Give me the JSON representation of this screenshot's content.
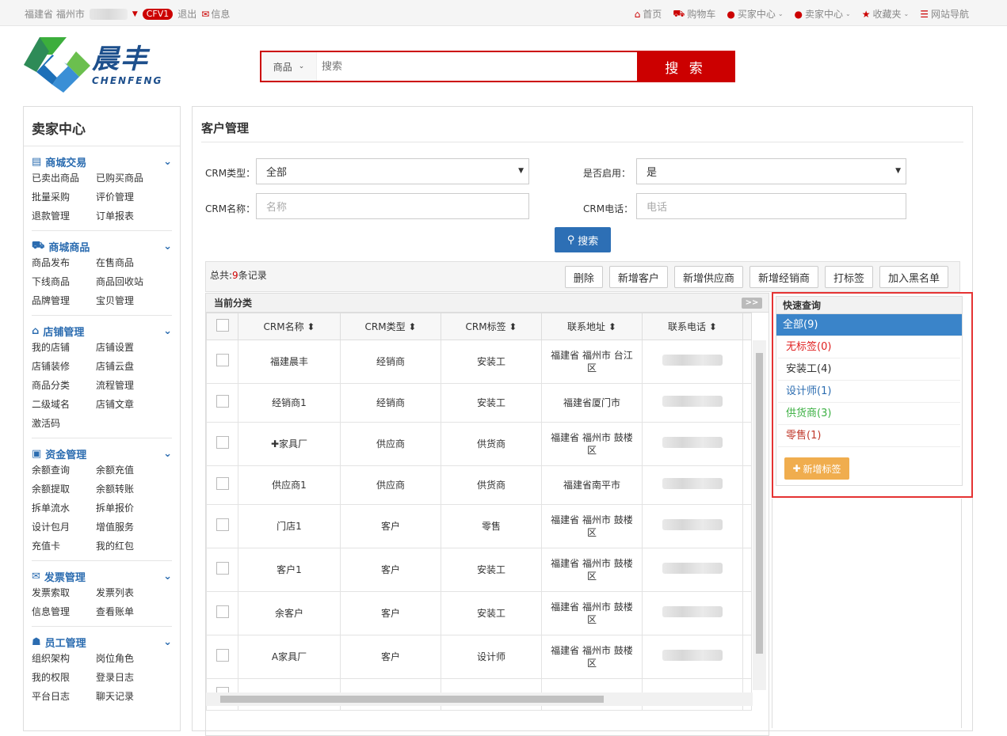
{
  "topbar": {
    "location": "福建省 福州市",
    "badge": "CFV1",
    "logout": "退出",
    "message": "信息",
    "right": {
      "home": "首页",
      "cart": "购物车",
      "buyer": "买家中心",
      "seller": "卖家中心",
      "favorites": "收藏夹",
      "sitenav": "网站导航"
    }
  },
  "logo": {
    "cn": "晨丰",
    "en": "CHENFENG"
  },
  "search": {
    "category": "商品",
    "placeholder": "搜索",
    "button": "搜 索"
  },
  "sidebar": {
    "title": "卖家中心",
    "sections": [
      {
        "title": "商城交易",
        "items": [
          "已卖出商品",
          "已购买商品",
          "批量采购",
          "评价管理",
          "退款管理",
          "订单报表"
        ]
      },
      {
        "title": "商城商品",
        "items": [
          "商品发布",
          "在售商品",
          "下线商品",
          "商品回收站",
          "品牌管理",
          "宝贝管理"
        ]
      },
      {
        "title": "店铺管理",
        "items": [
          "我的店铺",
          "店铺设置",
          "店铺装修",
          "店铺云盘",
          "商品分类",
          "流程管理",
          "二级域名",
          "店铺文章",
          "激活码"
        ]
      },
      {
        "title": "资金管理",
        "items": [
          "余额查询",
          "余额充值",
          "余额提取",
          "余额转账",
          "拆单流水",
          "拆单报价",
          "设计包月",
          "增值服务",
          "充值卡",
          "我的红包"
        ]
      },
      {
        "title": "发票管理",
        "items": [
          "发票索取",
          "发票列表",
          "信息管理",
          "查看账单"
        ]
      },
      {
        "title": "员工管理",
        "items": [
          "组织架构",
          "岗位角色",
          "我的权限",
          "登录日志",
          "平台日志",
          "聊天记录"
        ]
      }
    ]
  },
  "main": {
    "title": "客户管理",
    "filters": {
      "crm_type_label": "CRM类型：",
      "crm_type_value": "全部",
      "enabled_label": "是否启用：",
      "enabled_value": "是",
      "crm_name_label": "CRM名称：",
      "crm_name_placeholder": "名称",
      "crm_phone_label": "CRM电话：",
      "crm_phone_placeholder": "电话",
      "search_button": "搜索"
    },
    "toolbar": {
      "total_prefix": "总共:",
      "total_count": "9",
      "total_suffix": "条记录",
      "buttons": [
        "删除",
        "新增客户",
        "新增供应商",
        "新增经销商",
        "打标签",
        "加入黑名单"
      ]
    },
    "grid": {
      "caption": "当前分类",
      "toggle": ">>",
      "columns": [
        "CRM名称",
        "CRM类型",
        "CRM标签",
        "联系地址",
        "联系电话"
      ],
      "rows": [
        {
          "name": "福建晨丰",
          "type": "经销商",
          "tag": "安装工",
          "address": "福建省 福州市 台江区"
        },
        {
          "name": "经销商1",
          "type": "经销商",
          "tag": "安装工",
          "address": "福建省厦门市"
        },
        {
          "name": "✚家具厂",
          "type": "供应商",
          "tag": "供货商",
          "address": "福建省 福州市 鼓楼区"
        },
        {
          "name": "供应商1",
          "type": "供应商",
          "tag": "供货商",
          "address": "福建省南平市"
        },
        {
          "name": "门店1",
          "type": "客户",
          "tag": "零售",
          "address": "福建省 福州市 鼓楼区"
        },
        {
          "name": "客户1",
          "type": "客户",
          "tag": "安装工",
          "address": "福建省 福州市 鼓楼区"
        },
        {
          "name": "余客户",
          "type": "客户",
          "tag": "安装工",
          "address": "福建省 福州市 鼓楼区"
        },
        {
          "name": "A家具厂",
          "type": "客户",
          "tag": "设计师",
          "address": "福建省 福州市 鼓楼区"
        }
      ]
    },
    "quick": {
      "title": "快速查询",
      "items": [
        {
          "label": "全部(9)",
          "color": "#ffffff"
        },
        {
          "label": "无标签(0)",
          "color": "#e02020"
        },
        {
          "label": "安装工(4)",
          "color": "#333333"
        },
        {
          "label": "设计师(1)",
          "color": "#2b6cb0"
        },
        {
          "label": "供货商(3)",
          "color": "#3cb043"
        },
        {
          "label": "零售(1)",
          "color": "#c0392b"
        }
      ],
      "add_button": "新增标签"
    }
  }
}
